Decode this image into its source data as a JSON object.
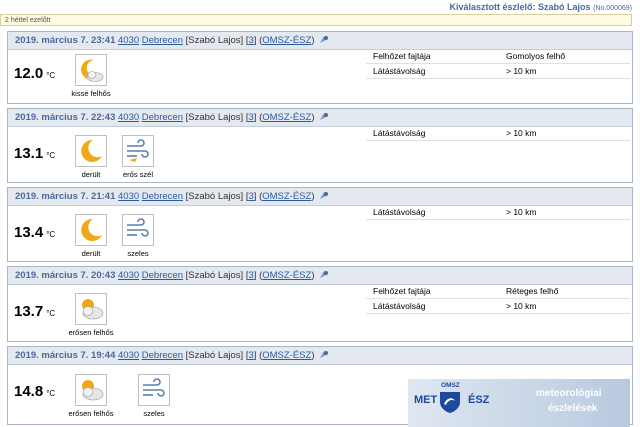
{
  "header": {
    "title": "Kiválasztott észlelő: Szabó Lajos",
    "observer_id": "(No.000069)",
    "age_note": "2 héttel ezelőtt"
  },
  "observations": [
    {
      "date": "2019. március 7. 23:41",
      "zip": "4030",
      "city": "Debrecen",
      "observer": "[Szabó Lajos]",
      "count_open": "[",
      "count": "3",
      "count_close": "]",
      "net_open": "(",
      "network": "OMSZ-ÉSZ",
      "net_close": ")",
      "temp": "12.0",
      "unit": "°C",
      "icons": [
        {
          "icon": "moon-cloud-icon",
          "label": "kissé felhős"
        }
      ],
      "props": [
        {
          "k": "Felhőzet fajtája",
          "v": "Gomolyos felhő"
        },
        {
          "k": "Látástávolság",
          "v": "> 10 km"
        }
      ]
    },
    {
      "date": "2019. március 7. 22:43",
      "zip": "4030",
      "city": "Debrecen",
      "observer": "[Szabó Lajos]",
      "count_open": "[",
      "count": "3",
      "count_close": "]",
      "net_open": "(",
      "network": "OMSZ-ÉSZ",
      "net_close": ")",
      "temp": "13.1",
      "unit": "°C",
      "icons": [
        {
          "icon": "moon-icon",
          "label": "derült"
        },
        {
          "icon": "strong-wind-icon",
          "label": "erős szél"
        }
      ],
      "props": [
        {
          "k": "Látástávolság",
          "v": "> 10 km"
        }
      ]
    },
    {
      "date": "2019. március 7. 21:41",
      "zip": "4030",
      "city": "Debrecen",
      "observer": "[Szabó Lajos]",
      "count_open": "[",
      "count": "3",
      "count_close": "]",
      "net_open": "(",
      "network": "OMSZ-ÉSZ",
      "net_close": ")",
      "temp": "13.4",
      "unit": "°C",
      "icons": [
        {
          "icon": "moon-icon",
          "label": "derült"
        },
        {
          "icon": "wind-icon",
          "label": "szeles"
        }
      ],
      "props": [
        {
          "k": "Látástávolság",
          "v": "> 10 km"
        }
      ]
    },
    {
      "date": "2019. március 7. 20:43",
      "zip": "4030",
      "city": "Debrecen",
      "observer": "[Szabó Lajos]",
      "count_open": "[",
      "count": "3",
      "count_close": "]",
      "net_open": "(",
      "network": "OMSZ-ÉSZ",
      "net_close": ")",
      "temp": "13.7",
      "unit": "°C",
      "icons": [
        {
          "icon": "mostly-cloudy-icon",
          "label": "erősen felhős"
        }
      ],
      "props": [
        {
          "k": "Felhőzet fajtája",
          "v": "Réteges felhő"
        },
        {
          "k": "Látástávolság",
          "v": "> 10 km"
        }
      ]
    },
    {
      "date": "2019. március 7. 19:44",
      "zip": "4030",
      "city": "Debrecen",
      "observer": "[Szabó Lajos]",
      "count_open": "[",
      "count": "3",
      "count_close": "]",
      "net_open": "(",
      "network": "OMSZ-ÉSZ",
      "net_close": ")",
      "temp": "14.8",
      "unit": "°C",
      "icons": [
        {
          "icon": "mostly-cloudy-icon",
          "label": "erősen felhős"
        },
        {
          "icon": "wind-icon",
          "label": "szeles"
        }
      ],
      "props": []
    }
  ],
  "banner": {
    "met": "MET",
    "omsz": "OMSZ",
    "esz": "ÉSZ",
    "line1": "meteorológiai",
    "line2": "észlelések"
  },
  "colors": {
    "header_bg": "#e4e9f0",
    "link": "#2b5aa0",
    "title": "#4a6a9a",
    "moon": "#f0a818"
  }
}
